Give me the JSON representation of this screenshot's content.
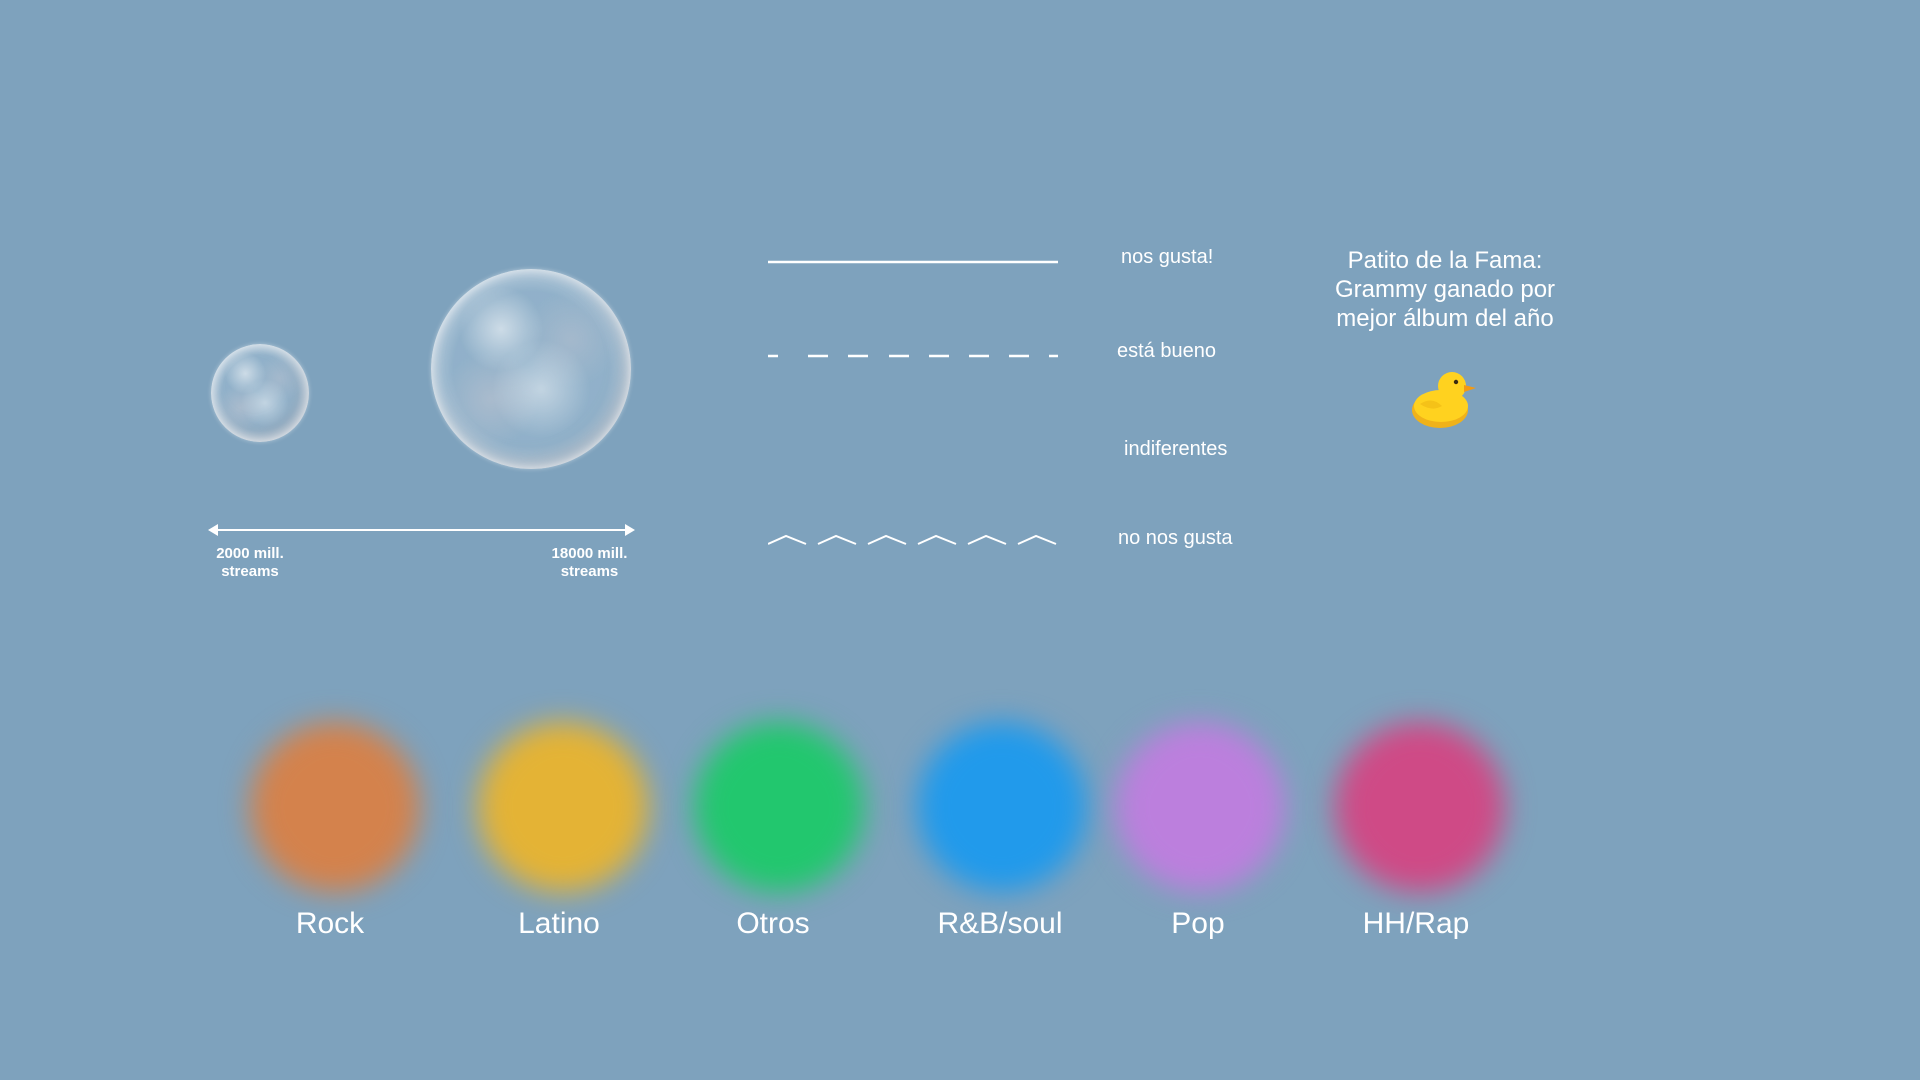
{
  "size_legend": {
    "min_label": "2000 mill.\nstreams",
    "max_label": "18000 mill.\nstreams"
  },
  "line_legend": [
    {
      "style": "solid",
      "label": "nos gusta!"
    },
    {
      "style": "dashed",
      "label": "está bueno"
    },
    {
      "style": "none",
      "label": "indiferentes"
    },
    {
      "style": "zigzag",
      "label": "no nos gusta"
    }
  ],
  "duck_legend": {
    "title": "Patito de la Fama:\nGrammy ganado por\nmejor álbum del año",
    "icon": "rubber-duck-icon"
  },
  "genres": [
    {
      "label": "Rock",
      "color": "#d4824c"
    },
    {
      "label": "Latino",
      "color": "#e4b335"
    },
    {
      "label": "Otros",
      "color": "#22c76e"
    },
    {
      "label": "R&B/soul",
      "color": "#219aeb"
    },
    {
      "label": "Pop",
      "color": "#bc7fdd"
    },
    {
      "label": "HH/Rap",
      "color": "#cf4a86"
    }
  ]
}
